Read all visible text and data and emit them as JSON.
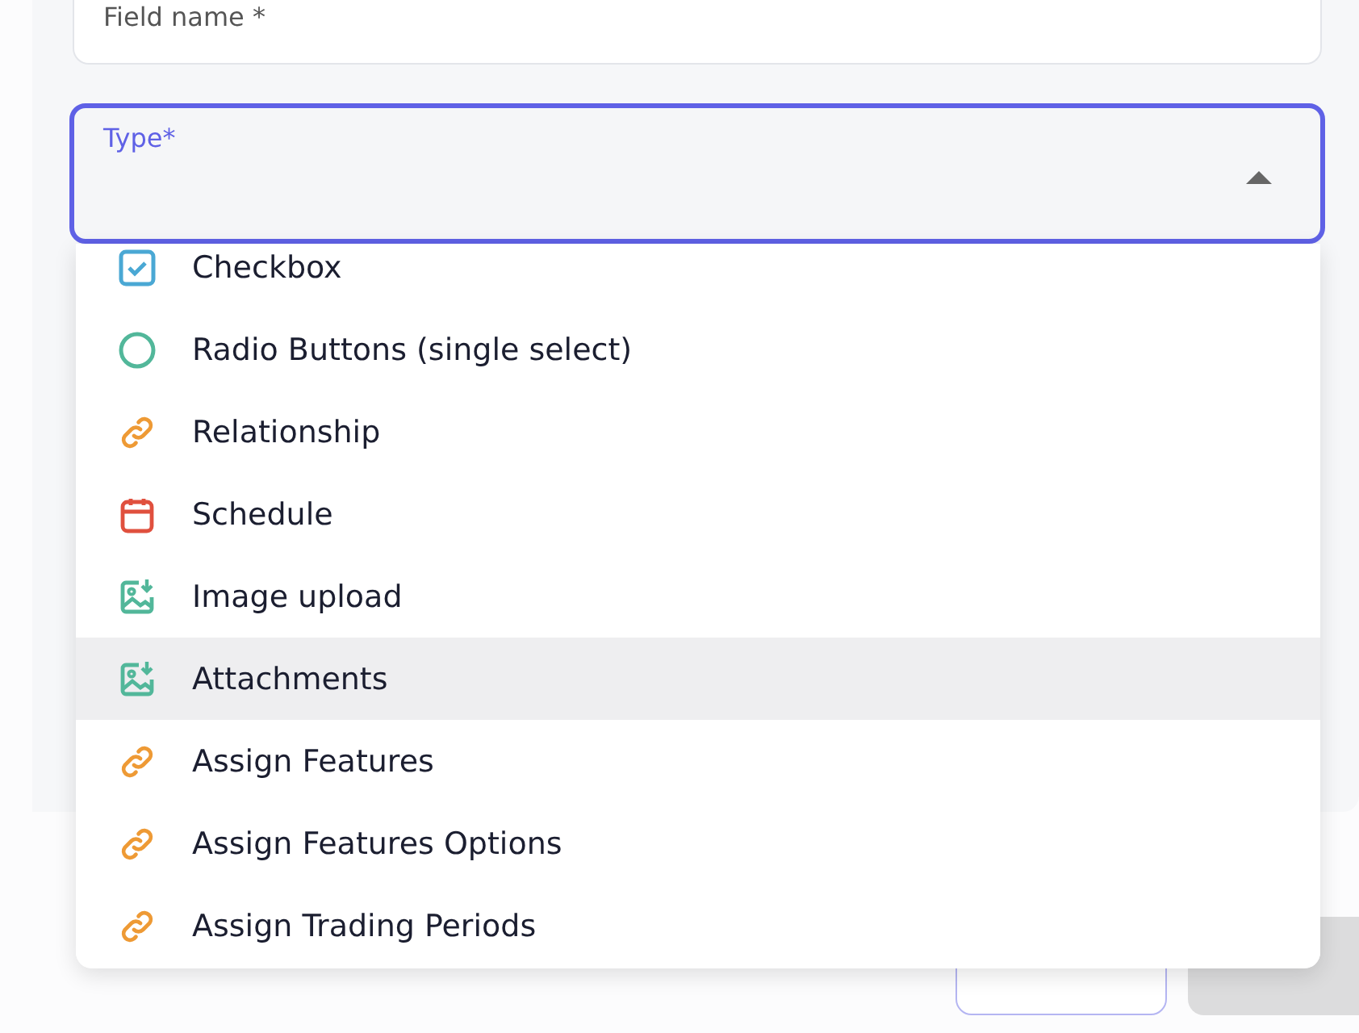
{
  "form": {
    "field_name": {
      "label": "Field name *"
    },
    "type_select": {
      "label": "Type*",
      "expanded": true
    },
    "options": [
      {
        "label": "Checkbox",
        "kind": "checkbox",
        "highlighted": false
      },
      {
        "label": "Radio Buttons (single select)",
        "kind": "radio",
        "highlighted": false
      },
      {
        "label": "Relationship",
        "kind": "link",
        "highlighted": false
      },
      {
        "label": "Schedule",
        "kind": "calendar",
        "highlighted": false
      },
      {
        "label": "Image upload",
        "kind": "image",
        "highlighted": false
      },
      {
        "label": "Attachments",
        "kind": "image",
        "highlighted": true
      },
      {
        "label": "Assign Features",
        "kind": "link",
        "highlighted": false
      },
      {
        "label": "Assign Features Options",
        "kind": "link",
        "highlighted": false
      },
      {
        "label": "Assign Trading Periods",
        "kind": "link",
        "highlighted": false
      }
    ]
  },
  "buttons": [
    {
      "kind": "secondary"
    },
    {
      "kind": "primary",
      "disabled": true
    }
  ]
}
